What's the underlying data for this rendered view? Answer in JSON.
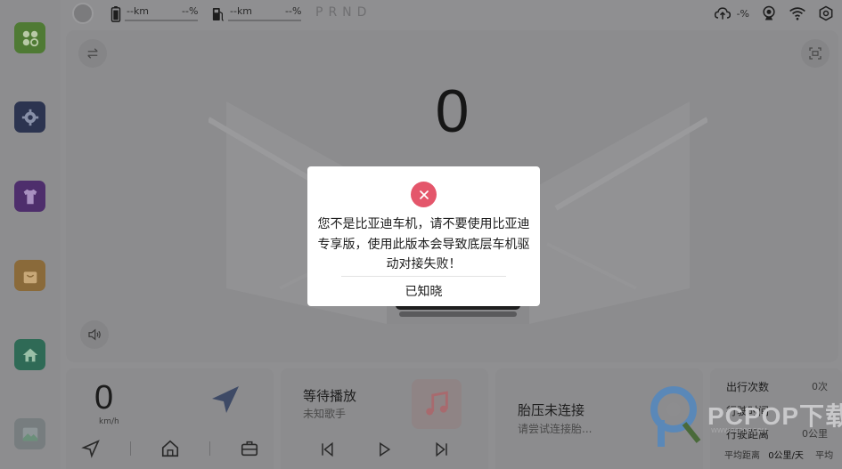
{
  "status_bar": {
    "battery_range": "--km",
    "battery_pct": "--%",
    "fuel_range": "--km",
    "fuel_pct": "--%",
    "gears": "PRND",
    "cloud_pct": "-%"
  },
  "dashboard": {
    "speed": "0"
  },
  "nav_card": {
    "speed": "0",
    "unit": "km/h"
  },
  "music_card": {
    "title": "等待播放",
    "artist": "未知歌手"
  },
  "tire_card": {
    "title": "胎压未连接",
    "subtitle": "请尝试连接胎..."
  },
  "stats_card": {
    "rows": [
      {
        "label": "出行次数",
        "value": "0次"
      },
      {
        "label": "行驶时间",
        "value": ""
      },
      {
        "label": "行驶距离",
        "value": "0公里"
      }
    ],
    "footer_label": "平均距离",
    "footer_value": "0公里/天",
    "footer_extra": "平均"
  },
  "watermark": {
    "text": "PCPOP下载",
    "sub": "WWW.PCPOP.COM"
  },
  "modal": {
    "message": "您不是比亚迪车机，请不要使用比亚迪专享版，使用此版本会导致底层车机驱动对接失败！",
    "confirm_label": "已知晓"
  },
  "colors": {
    "overlay_gray": "#8d8d8f",
    "error_red": "#e4566b",
    "modal_bg": "#ffffff"
  }
}
